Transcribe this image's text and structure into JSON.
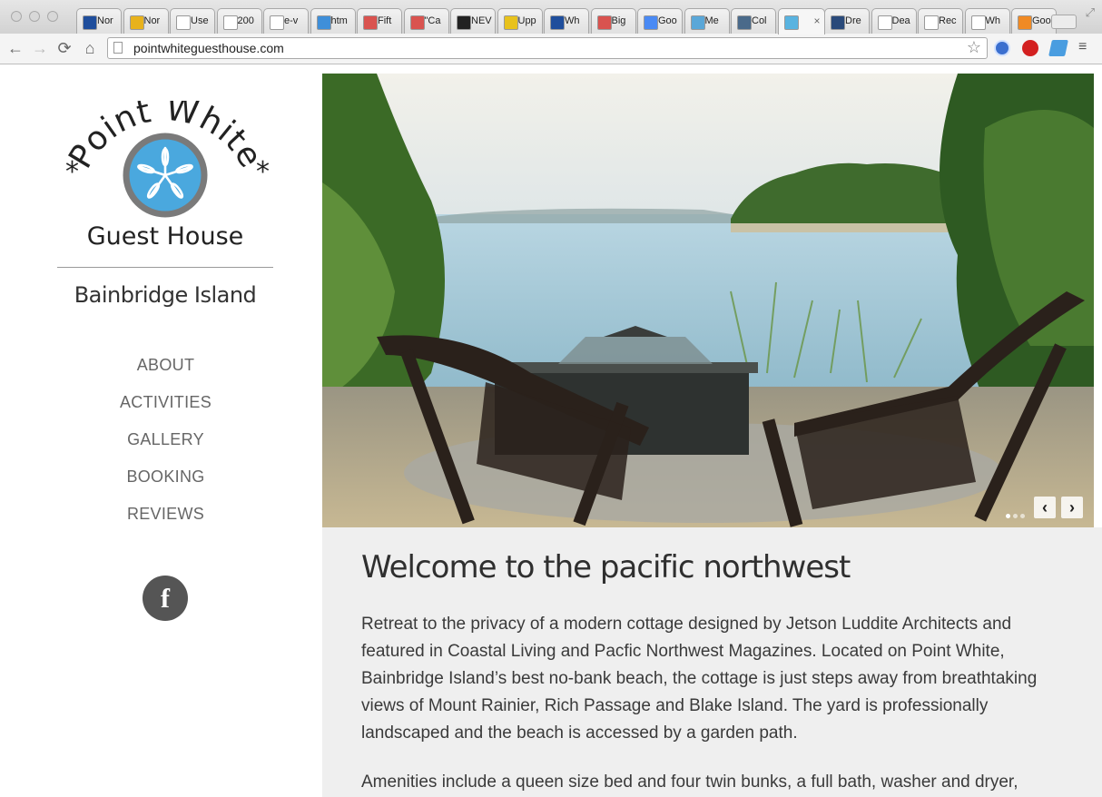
{
  "browser": {
    "tabs": [
      {
        "label": "Nor",
        "color": "#1f4e9c"
      },
      {
        "label": "Nor",
        "color": "#e8b21c"
      },
      {
        "label": "Use",
        "color": "#ffffff"
      },
      {
        "label": "200",
        "color": "#ffffff"
      },
      {
        "label": "e-v",
        "color": "#ffffff"
      },
      {
        "label": "htm",
        "color": "#3f8fd9"
      },
      {
        "label": "Fift",
        "color": "#d9534f"
      },
      {
        "label": "\"Ca",
        "color": "#d9534f"
      },
      {
        "label": "NEV",
        "color": "#222222"
      },
      {
        "label": "Upp",
        "color": "#e8c21c"
      },
      {
        "label": "Wh",
        "color": "#1f4e9c"
      },
      {
        "label": "Big",
        "color": "#d9534f"
      },
      {
        "label": "Goo",
        "color": "#4a8af4"
      },
      {
        "label": "Me",
        "color": "#5aa7d8"
      },
      {
        "label": "Col",
        "color": "#4a6a8a"
      },
      {
        "label": "",
        "color": "#59b3e0"
      },
      {
        "label": "Dre",
        "color": "#2a4a7a"
      },
      {
        "label": "Dea",
        "color": "#ffffff"
      },
      {
        "label": "Rec",
        "color": "#ffffff"
      },
      {
        "label": "Wh",
        "color": "#ffffff"
      },
      {
        "label": "Goo",
        "color": "#f08a24"
      }
    ],
    "active_tab_index": 15,
    "close_glyph": "×",
    "url": "pointwhiteguesthouse.com",
    "back_icon": "←",
    "forward_icon": "→",
    "reload_icon": "⟳",
    "home_icon": "⌂",
    "star_icon": "☆",
    "menu_icon": "≡"
  },
  "logo": {
    "top_text": "Point White",
    "bottom_text": "Guest House",
    "star_glyph": "*",
    "sand_dollar_color": "#4aa8de",
    "ring_color": "#7a7a7a"
  },
  "location": "Bainbridge Island",
  "nav": {
    "items": [
      "ABOUT",
      "ACTIVITIES",
      "GALLERY",
      "BOOKING",
      "REVIEWS"
    ]
  },
  "social": {
    "facebook_glyph": "f"
  },
  "slider": {
    "prev_glyph": "‹",
    "next_glyph": "›",
    "slide_count": 3,
    "current_slide": 1
  },
  "content": {
    "heading": "Welcome to the pacific northwest",
    "paragraph1": "Retreat to the privacy of a modern cottage designed by Jetson Luddite Architects and featured in Coastal Living and Pacfic Northwest Magazines. Located on Point White, Bainbridge Island’s best no-bank beach, the cottage is just steps away from breathtaking views of Mount Rainier, Rich Passage and Blake Island. The yard is professionally landscaped and the beach is accessed by a garden path.",
    "paragraph2": "Amenities include a queen size bed and four twin bunks, a full bath, washer and dryer,"
  },
  "colors": {
    "content_bg": "#efefef",
    "nav_text": "#666666",
    "facebook_bg": "#555555"
  }
}
